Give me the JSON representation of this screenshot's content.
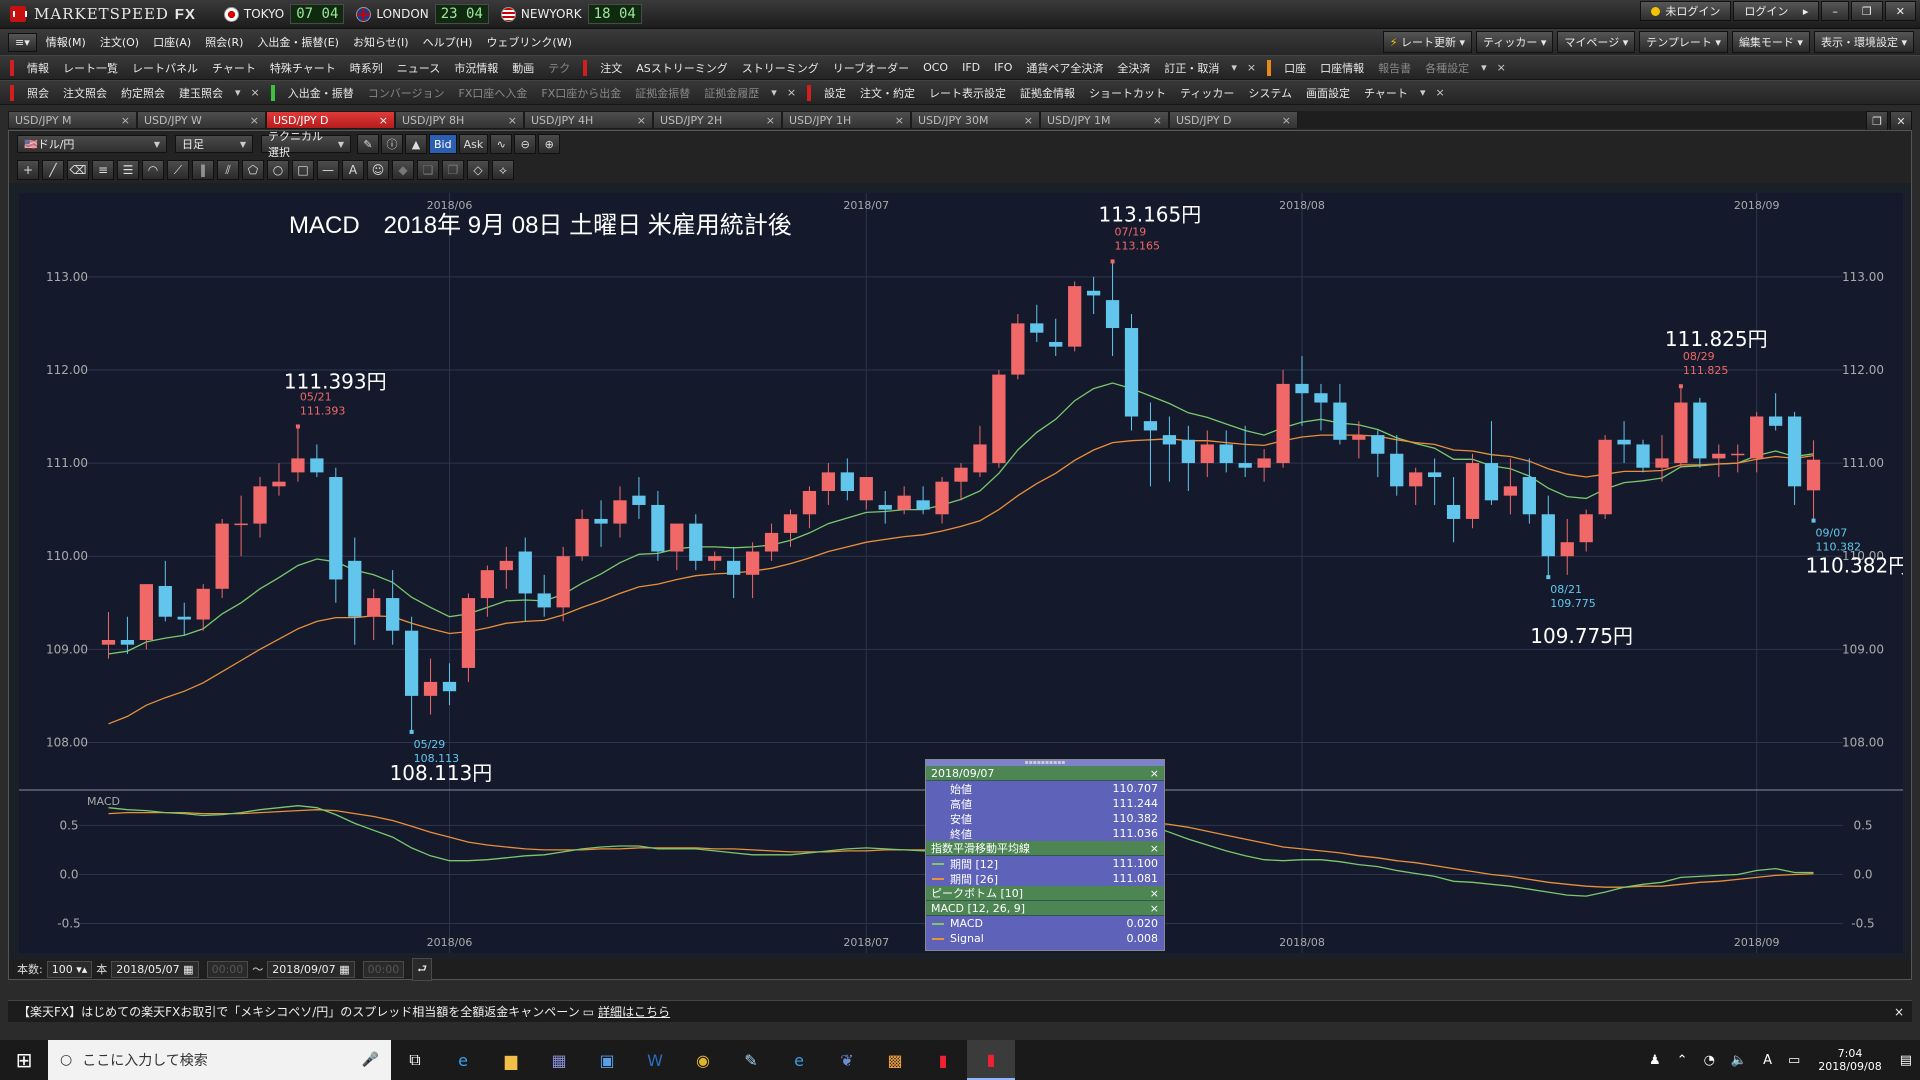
{
  "app": {
    "title": "MARKETSPEED FX",
    "title_a": "MARKETSPEED",
    "title_b": "FX"
  },
  "clocks": [
    {
      "city": "TOKYO",
      "time": "07 04"
    },
    {
      "city": "LONDON",
      "time": "23 04"
    },
    {
      "city": "NEWYORK",
      "time": "18 04"
    }
  ],
  "title_buttons": {
    "login_status": "未ログイン",
    "login": "ログイン"
  },
  "menus": [
    "情報(M)",
    "注文(O)",
    "口座(A)",
    "照会(R)",
    "入出金・振替(E)",
    "お知らせ(I)",
    "ヘルプ(H)",
    "ウェブリンク(W)"
  ],
  "menu_right": [
    "レート更新",
    "ティッカー",
    "マイページ",
    "テンプレート",
    "編集モード",
    "表示・環境設定"
  ],
  "toolbar1": {
    "group1": [
      "情報",
      "レート一覧",
      "レートパネル",
      "チャート",
      "特殊チャート",
      "時系列",
      "ニュース",
      "市況情報",
      "動画",
      "テク"
    ],
    "group2": [
      "注文",
      "ASストリーミング",
      "ストリーミング",
      "リーブオーダー",
      "OCO",
      "IFD",
      "IFO",
      "通貨ペア全決済",
      "全決済",
      "訂正・取消"
    ],
    "group3": [
      "口座",
      "口座情報",
      "報告書",
      "各種設定"
    ]
  },
  "toolbar2": {
    "group1": [
      "照会",
      "注文照会",
      "約定照会",
      "建玉照会"
    ],
    "group2": [
      "入出金・振替",
      "コンバージョン",
      "FX口座へ入金",
      "FX口座から出金",
      "証拠金振替",
      "証拠金履歴"
    ],
    "group3": [
      "設定",
      "注文・約定",
      "レート表示設定",
      "証拠金情報",
      "ショートカット",
      "ティッカー",
      "システム",
      "画面設定",
      "チャート"
    ]
  },
  "tabs": [
    "USD/JPY M",
    "USD/JPY W",
    "USD/JPY D",
    "USD/JPY 8H",
    "USD/JPY 4H",
    "USD/JPY 2H",
    "USD/JPY 1H",
    "USD/JPY 30M",
    "USD/JPY 1M",
    "USD/JPY D"
  ],
  "active_tab": 2,
  "chart_controls": {
    "pair": "ドル/円",
    "period": "日足",
    "technical": "テクニカル選択",
    "bid": "Bid",
    "ask": "Ask"
  },
  "colors": {
    "up": "#f06868",
    "down": "#62c6ec",
    "ema12": "#7bc86c",
    "ema26": "#e8903a",
    "bg": "#141a2c",
    "text": "#ffffff"
  },
  "annotation_title": "MACD　2018年 9月 08日 土曜日 米雇用統計後",
  "callouts": {
    "a": {
      "big": "111.393円",
      "date": "05/21",
      "val": "111.393"
    },
    "b": {
      "big": "108.113円",
      "date": "05/29",
      "val": "108.113"
    },
    "c": {
      "big": "113.165円",
      "date": "07/19",
      "val": "113.165"
    },
    "d": {
      "big": "109.775円",
      "date": "08/21",
      "val": "109.775"
    },
    "e": {
      "big": "111.825円",
      "date": "08/29",
      "val": "111.825"
    },
    "f": {
      "big": "110.382円",
      "date": "09/07",
      "val": "110.382"
    }
  },
  "info_panel": {
    "date": "2018/09/07",
    "ohlc": [
      {
        "label": "始値",
        "value": "110.707"
      },
      {
        "label": "高値",
        "value": "111.244"
      },
      {
        "label": "安値",
        "value": "110.382"
      },
      {
        "label": "終値",
        "value": "111.036"
      }
    ],
    "ema_title": "指数平滑移動平均線",
    "ema": [
      {
        "label": "期間 [12]",
        "value": "111.100"
      },
      {
        "label": "期間 [26]",
        "value": "111.081"
      }
    ],
    "peak_title": "ピークボトム [10]",
    "macd_title": "MACD [12, 26, 9]",
    "macd": [
      {
        "label": "MACD",
        "value": "0.020"
      },
      {
        "label": "Signal",
        "value": "0.008"
      }
    ]
  },
  "status": {
    "count_label": "本数:",
    "count_value": "100",
    "unit": "本",
    "from": "2018/05/07",
    "from_time": "00:00",
    "tilde": "〜",
    "to": "2018/09/07",
    "to_time": "00:00"
  },
  "news": {
    "text": "【楽天FX】はじめての楽天FXお取引で「メキシコペソ/円」のスプレッド相当額を全額返金キャンペーン",
    "link": "詳細はこちら"
  },
  "taskbar": {
    "search_placeholder": "ここに入力して検索",
    "time": "7:04",
    "date": "2018/09/08",
    "ime": "A"
  },
  "chart_data": {
    "type": "candlestick",
    "title": "MACD　2018年 9月 08日 土曜日 米雇用統計後",
    "y_axis": {
      "min": 107.5,
      "max": 113.9,
      "ticks": [
        108.0,
        109.0,
        110.0,
        111.0,
        112.0,
        113.0
      ],
      "tick_labels": [
        "108.00",
        "109.00",
        "110.00",
        "111.00",
        "112.00",
        "113.00"
      ]
    },
    "x_axis": {
      "tick_labels": [
        "2018/06",
        "2018/07",
        "2018/08",
        "2018/09"
      ],
      "tick_index": [
        18,
        40,
        63,
        87
      ]
    },
    "candles": [
      {
        "o": 109.05,
        "h": 109.4,
        "l": 108.9,
        "c": 109.1
      },
      {
        "o": 109.1,
        "h": 109.35,
        "l": 108.95,
        "c": 109.05
      },
      {
        "o": 109.1,
        "h": 109.7,
        "l": 109.0,
        "c": 109.7
      },
      {
        "o": 109.68,
        "h": 109.95,
        "l": 109.3,
        "c": 109.35
      },
      {
        "o": 109.35,
        "h": 109.5,
        "l": 109.15,
        "c": 109.32
      },
      {
        "o": 109.32,
        "h": 109.7,
        "l": 109.2,
        "c": 109.65
      },
      {
        "o": 109.65,
        "h": 110.4,
        "l": 109.55,
        "c": 110.35
      },
      {
        "o": 110.35,
        "h": 110.65,
        "l": 110.0,
        "c": 110.35
      },
      {
        "o": 110.35,
        "h": 110.85,
        "l": 110.2,
        "c": 110.75
      },
      {
        "o": 110.75,
        "h": 111.0,
        "l": 110.65,
        "c": 110.8
      },
      {
        "o": 110.9,
        "h": 111.393,
        "l": 110.8,
        "c": 111.05
      },
      {
        "o": 111.05,
        "h": 111.2,
        "l": 110.85,
        "c": 110.9
      },
      {
        "o": 110.85,
        "h": 110.95,
        "l": 109.5,
        "c": 109.75
      },
      {
        "o": 109.95,
        "h": 110.2,
        "l": 109.05,
        "c": 109.35
      },
      {
        "o": 109.35,
        "h": 109.65,
        "l": 109.1,
        "c": 109.55
      },
      {
        "o": 109.55,
        "h": 109.85,
        "l": 109.05,
        "c": 109.2
      },
      {
        "o": 109.2,
        "h": 109.35,
        "l": 108.113,
        "c": 108.5
      },
      {
        "o": 108.5,
        "h": 108.9,
        "l": 108.3,
        "c": 108.65
      },
      {
        "o": 108.65,
        "h": 108.85,
        "l": 108.4,
        "c": 108.55
      },
      {
        "o": 108.8,
        "h": 109.6,
        "l": 108.65,
        "c": 109.55
      },
      {
        "o": 109.55,
        "h": 109.9,
        "l": 109.35,
        "c": 109.85
      },
      {
        "o": 109.85,
        "h": 110.1,
        "l": 109.65,
        "c": 109.95
      },
      {
        "o": 110.05,
        "h": 110.2,
        "l": 109.3,
        "c": 109.6
      },
      {
        "o": 109.6,
        "h": 109.8,
        "l": 109.35,
        "c": 109.45
      },
      {
        "o": 109.45,
        "h": 110.1,
        "l": 109.3,
        "c": 110.0
      },
      {
        "o": 110.0,
        "h": 110.5,
        "l": 109.95,
        "c": 110.4
      },
      {
        "o": 110.4,
        "h": 110.6,
        "l": 110.1,
        "c": 110.35
      },
      {
        "o": 110.35,
        "h": 110.75,
        "l": 110.2,
        "c": 110.6
      },
      {
        "o": 110.65,
        "h": 110.85,
        "l": 110.4,
        "c": 110.55
      },
      {
        "o": 110.55,
        "h": 110.7,
        "l": 109.95,
        "c": 110.05
      },
      {
        "o": 110.05,
        "h": 110.35,
        "l": 109.85,
        "c": 110.35
      },
      {
        "o": 110.35,
        "h": 110.45,
        "l": 109.85,
        "c": 109.95
      },
      {
        "o": 109.95,
        "h": 110.05,
        "l": 109.85,
        "c": 110.0
      },
      {
        "o": 109.95,
        "h": 110.1,
        "l": 109.55,
        "c": 109.8
      },
      {
        "o": 109.8,
        "h": 110.15,
        "l": 109.55,
        "c": 110.05
      },
      {
        "o": 110.05,
        "h": 110.35,
        "l": 109.95,
        "c": 110.25
      },
      {
        "o": 110.25,
        "h": 110.5,
        "l": 110.1,
        "c": 110.45
      },
      {
        "o": 110.45,
        "h": 110.75,
        "l": 110.3,
        "c": 110.7
      },
      {
        "o": 110.7,
        "h": 111.0,
        "l": 110.55,
        "c": 110.9
      },
      {
        "o": 110.9,
        "h": 111.05,
        "l": 110.6,
        "c": 110.7
      },
      {
        "o": 110.6,
        "h": 110.85,
        "l": 110.5,
        "c": 110.85
      },
      {
        "o": 110.55,
        "h": 110.7,
        "l": 110.35,
        "c": 110.5
      },
      {
        "o": 110.5,
        "h": 110.75,
        "l": 110.45,
        "c": 110.65
      },
      {
        "o": 110.6,
        "h": 110.75,
        "l": 110.45,
        "c": 110.5
      },
      {
        "o": 110.45,
        "h": 110.85,
        "l": 110.35,
        "c": 110.8
      },
      {
        "o": 110.8,
        "h": 111.0,
        "l": 110.6,
        "c": 110.95
      },
      {
        "o": 110.9,
        "h": 111.4,
        "l": 110.85,
        "c": 111.2
      },
      {
        "o": 111.0,
        "h": 112.0,
        "l": 110.95,
        "c": 111.95
      },
      {
        "o": 111.95,
        "h": 112.6,
        "l": 111.9,
        "c": 112.5
      },
      {
        "o": 112.5,
        "h": 112.7,
        "l": 112.3,
        "c": 112.4
      },
      {
        "o": 112.3,
        "h": 112.55,
        "l": 112.15,
        "c": 112.25
      },
      {
        "o": 112.25,
        "h": 112.95,
        "l": 112.2,
        "c": 112.9
      },
      {
        "o": 112.85,
        "h": 113.0,
        "l": 112.6,
        "c": 112.8
      },
      {
        "o": 112.75,
        "h": 113.165,
        "l": 112.15,
        "c": 112.45
      },
      {
        "o": 112.45,
        "h": 112.6,
        "l": 111.35,
        "c": 111.5
      },
      {
        "o": 111.45,
        "h": 111.65,
        "l": 110.75,
        "c": 111.35
      },
      {
        "o": 111.3,
        "h": 111.5,
        "l": 110.8,
        "c": 111.2
      },
      {
        "o": 111.25,
        "h": 111.4,
        "l": 110.7,
        "c": 111.0
      },
      {
        "o": 111.0,
        "h": 111.35,
        "l": 110.85,
        "c": 111.2
      },
      {
        "o": 111.2,
        "h": 111.35,
        "l": 110.9,
        "c": 111.0
      },
      {
        "o": 111.0,
        "h": 111.4,
        "l": 110.85,
        "c": 110.95
      },
      {
        "o": 110.95,
        "h": 111.15,
        "l": 110.8,
        "c": 111.05
      },
      {
        "o": 111.0,
        "h": 112.0,
        "l": 110.95,
        "c": 111.85
      },
      {
        "o": 111.85,
        "h": 112.15,
        "l": 111.4,
        "c": 111.75
      },
      {
        "o": 111.75,
        "h": 111.85,
        "l": 111.35,
        "c": 111.65
      },
      {
        "o": 111.65,
        "h": 111.85,
        "l": 111.2,
        "c": 111.25
      },
      {
        "o": 111.25,
        "h": 111.45,
        "l": 111.05,
        "c": 111.3
      },
      {
        "o": 111.3,
        "h": 111.35,
        "l": 110.85,
        "c": 111.1
      },
      {
        "o": 111.1,
        "h": 111.3,
        "l": 110.65,
        "c": 110.75
      },
      {
        "o": 110.75,
        "h": 110.95,
        "l": 110.55,
        "c": 110.9
      },
      {
        "o": 110.9,
        "h": 111.05,
        "l": 110.55,
        "c": 110.85
      },
      {
        "o": 110.55,
        "h": 110.85,
        "l": 110.15,
        "c": 110.4
      },
      {
        "o": 110.4,
        "h": 111.1,
        "l": 110.3,
        "c": 111.0
      },
      {
        "o": 111.0,
        "h": 111.45,
        "l": 110.55,
        "c": 110.6
      },
      {
        "o": 110.65,
        "h": 111.05,
        "l": 110.45,
        "c": 110.75
      },
      {
        "o": 110.85,
        "h": 111.05,
        "l": 110.35,
        "c": 110.45
      },
      {
        "o": 110.45,
        "h": 110.65,
        "l": 109.775,
        "c": 110.0
      },
      {
        "o": 110.0,
        "h": 110.4,
        "l": 109.8,
        "c": 110.15
      },
      {
        "o": 110.15,
        "h": 110.5,
        "l": 110.05,
        "c": 110.45
      },
      {
        "o": 110.45,
        "h": 111.3,
        "l": 110.4,
        "c": 111.25
      },
      {
        "o": 111.25,
        "h": 111.45,
        "l": 111.0,
        "c": 111.2
      },
      {
        "o": 111.2,
        "h": 111.25,
        "l": 110.9,
        "c": 110.95
      },
      {
        "o": 110.95,
        "h": 111.3,
        "l": 110.8,
        "c": 111.05
      },
      {
        "o": 111.0,
        "h": 111.825,
        "l": 110.95,
        "c": 111.65
      },
      {
        "o": 111.65,
        "h": 111.7,
        "l": 110.95,
        "c": 111.05
      },
      {
        "o": 111.05,
        "h": 111.2,
        "l": 110.85,
        "c": 111.1
      },
      {
        "o": 111.1,
        "h": 111.2,
        "l": 110.9,
        "c": 111.1
      },
      {
        "o": 111.05,
        "h": 111.55,
        "l": 110.9,
        "c": 111.5
      },
      {
        "o": 111.5,
        "h": 111.75,
        "l": 111.35,
        "c": 111.4
      },
      {
        "o": 111.5,
        "h": 111.55,
        "l": 110.55,
        "c": 110.75
      },
      {
        "o": 110.707,
        "h": 111.244,
        "l": 110.382,
        "c": 111.036
      }
    ],
    "ema": [
      {
        "name": "期間 [12]",
        "color": "#7bc86c",
        "values": [
          108.95,
          108.98,
          109.08,
          109.12,
          109.15,
          109.22,
          109.38,
          109.5,
          109.65,
          109.77,
          109.9,
          109.97,
          109.94,
          109.85,
          109.8,
          109.72,
          109.56,
          109.45,
          109.35,
          109.38,
          109.45,
          109.52,
          109.53,
          109.52,
          109.59,
          109.71,
          109.81,
          109.93,
          110.02,
          110.03,
          110.08,
          110.1,
          110.1,
          110.09,
          110.1,
          110.12,
          110.17,
          110.25,
          110.35,
          110.41,
          110.47,
          110.48,
          110.5,
          110.5,
          110.55,
          110.61,
          110.7,
          110.89,
          111.14,
          111.33,
          111.47,
          111.67,
          111.8,
          111.86,
          111.8,
          111.72,
          111.64,
          111.54,
          111.49,
          111.42,
          111.35,
          111.3,
          111.38,
          111.44,
          111.47,
          111.43,
          111.41,
          111.36,
          111.27,
          111.21,
          111.16,
          111.04,
          111.04,
          110.97,
          110.94,
          110.86,
          110.73,
          110.64,
          110.62,
          110.72,
          110.79,
          110.81,
          110.84,
          110.96,
          110.97,
          110.99,
          111.0,
          111.08,
          111.13,
          111.07,
          111.1
        ]
      },
      {
        "name": "期間 [26]",
        "color": "#e8903a",
        "values": [
          108.2,
          108.28,
          108.4,
          108.48,
          108.55,
          108.64,
          108.76,
          108.88,
          109.0,
          109.11,
          109.22,
          109.3,
          109.34,
          109.34,
          109.36,
          109.35,
          109.28,
          109.22,
          109.17,
          109.19,
          109.23,
          109.28,
          109.3,
          109.31,
          109.37,
          109.45,
          109.52,
          109.6,
          109.67,
          109.7,
          109.75,
          109.79,
          109.81,
          109.82,
          109.84,
          109.87,
          109.92,
          109.98,
          110.05,
          110.1,
          110.15,
          110.18,
          110.21,
          110.23,
          110.27,
          110.32,
          110.38,
          110.5,
          110.65,
          110.78,
          110.89,
          111.03,
          111.14,
          111.22,
          111.24,
          111.25,
          111.26,
          111.24,
          111.24,
          111.22,
          111.2,
          111.19,
          111.24,
          111.28,
          111.3,
          111.3,
          111.3,
          111.29,
          111.25,
          111.22,
          111.2,
          111.14,
          111.13,
          111.09,
          111.07,
          111.02,
          110.94,
          110.88,
          110.85,
          110.88,
          110.91,
          110.91,
          110.92,
          110.98,
          110.98,
          110.99,
          111.0,
          111.04,
          111.07,
          111.05,
          111.08
        ]
      }
    ],
    "macd_panel": {
      "label": "MACD",
      "y_ticks": [
        0.5,
        0.0,
        -0.5
      ],
      "y_tick_labels": [
        "0.5",
        "0.0",
        "-0.5"
      ],
      "y_range": [
        -0.8,
        0.85
      ],
      "macd": [
        0.68,
        0.66,
        0.65,
        0.63,
        0.62,
        0.6,
        0.61,
        0.63,
        0.66,
        0.68,
        0.7,
        0.68,
        0.61,
        0.52,
        0.45,
        0.38,
        0.27,
        0.19,
        0.14,
        0.14,
        0.15,
        0.17,
        0.19,
        0.2,
        0.23,
        0.26,
        0.28,
        0.29,
        0.29,
        0.26,
        0.26,
        0.26,
        0.24,
        0.22,
        0.2,
        0.2,
        0.2,
        0.22,
        0.24,
        0.26,
        0.27,
        0.26,
        0.25,
        0.24,
        0.25,
        0.26,
        0.28,
        0.35,
        0.45,
        0.53,
        0.59,
        0.64,
        0.67,
        0.66,
        0.58,
        0.5,
        0.43,
        0.36,
        0.3,
        0.24,
        0.19,
        0.15,
        0.14,
        0.15,
        0.15,
        0.13,
        0.1,
        0.08,
        0.04,
        0.01,
        -0.02,
        -0.07,
        -0.08,
        -0.1,
        -0.12,
        -0.15,
        -0.18,
        -0.21,
        -0.22,
        -0.18,
        -0.13,
        -0.1,
        -0.08,
        -0.03,
        -0.02,
        -0.01,
        0.0,
        0.04,
        0.06,
        0.02,
        0.02
      ],
      "signal": [
        0.62,
        0.63,
        0.63,
        0.63,
        0.63,
        0.62,
        0.62,
        0.62,
        0.63,
        0.64,
        0.65,
        0.66,
        0.65,
        0.62,
        0.59,
        0.55,
        0.49,
        0.43,
        0.38,
        0.33,
        0.3,
        0.28,
        0.26,
        0.25,
        0.25,
        0.25,
        0.26,
        0.26,
        0.27,
        0.27,
        0.27,
        0.27,
        0.26,
        0.26,
        0.25,
        0.24,
        0.23,
        0.23,
        0.23,
        0.24,
        0.24,
        0.25,
        0.25,
        0.25,
        0.25,
        0.25,
        0.26,
        0.28,
        0.31,
        0.36,
        0.41,
        0.46,
        0.5,
        0.53,
        0.54,
        0.53,
        0.51,
        0.48,
        0.44,
        0.4,
        0.36,
        0.32,
        0.28,
        0.26,
        0.24,
        0.22,
        0.19,
        0.17,
        0.14,
        0.12,
        0.09,
        0.06,
        0.03,
        0.0,
        -0.02,
        -0.05,
        -0.08,
        -0.1,
        -0.12,
        -0.13,
        -0.13,
        -0.12,
        -0.12,
        -0.1,
        -0.08,
        -0.07,
        -0.05,
        -0.03,
        -0.01,
        0.0,
        0.008
      ]
    }
  }
}
